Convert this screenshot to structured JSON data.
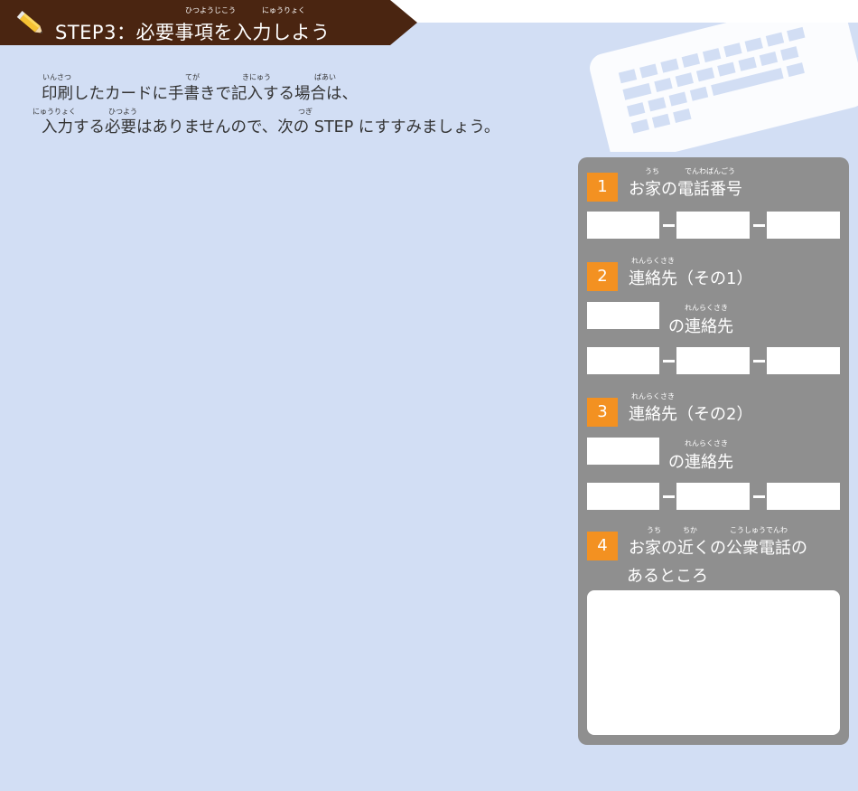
{
  "header": {
    "title": "STEP3：必要事項を入力しよう",
    "ruby_hitsuyoujikou": "ひつようじこう",
    "ruby_nyuuryoku": "にゅうりょく"
  },
  "instructions": {
    "line1": "印刷したカードに手書きで記入する場合は、",
    "line2": "入力する必要はありませんので、次の STEP にすすみましょう。",
    "ruby_insatsu": "いんさつ",
    "ruby_tega": "てが",
    "ruby_kinyuu": "きにゅう",
    "ruby_baai": "ばあい",
    "ruby_nyuuryoku": "にゅうりょく",
    "ruby_hitsuyou": "ひつよう",
    "ruby_tsugi": "つぎ"
  },
  "form": {
    "section1": {
      "number": "1",
      "label": "お家の電話番号",
      "ruby_uchi": "うち",
      "ruby_denwabangou": "でんわばんごう"
    },
    "section2": {
      "number": "2",
      "label": "連絡先（その1）",
      "ruby_renrakusaki": "れんらくさき",
      "sublabel": "の連絡先",
      "sub_ruby": "れんらくさき"
    },
    "section3": {
      "number": "3",
      "label": "連絡先（その2）",
      "ruby_renrakusaki": "れんらくさき",
      "sublabel": "の連絡先",
      "sub_ruby": "れんらくさき"
    },
    "section4": {
      "number": "4",
      "label_line1": "お家の近くの公衆電話の",
      "label_line2": "あるところ",
      "ruby_uchi": "うち",
      "ruby_chika": "ちか",
      "ruby_koushuudenwa": "こうしゅうでんわ"
    }
  },
  "icons": {
    "header": "pencil-icon",
    "decoration": "keyboard-icon"
  },
  "colors": {
    "background": "#d2def4",
    "banner": "#4a2511",
    "panel": "#8f8f8f",
    "number_badge": "#f39121",
    "pencil": "#f6c233"
  }
}
